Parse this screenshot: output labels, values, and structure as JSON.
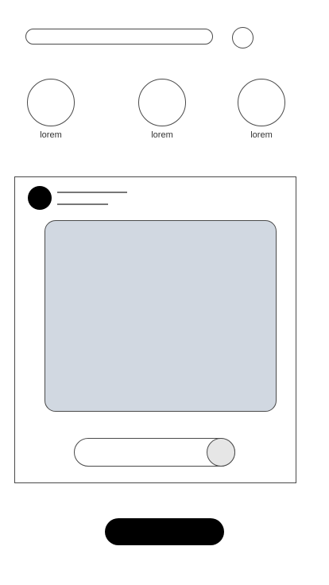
{
  "stories": [
    {
      "label": "lorem"
    },
    {
      "label": "lorem"
    },
    {
      "label": "lorem"
    }
  ],
  "colors": {
    "background": "#ffffff",
    "outline": "#4a4a4a",
    "media_fill": "#d1d8e1",
    "avatar": "#000000",
    "primary_button": "#000000",
    "toggle_knob": "#e6e6e6"
  },
  "toggle": {
    "state": "on"
  }
}
